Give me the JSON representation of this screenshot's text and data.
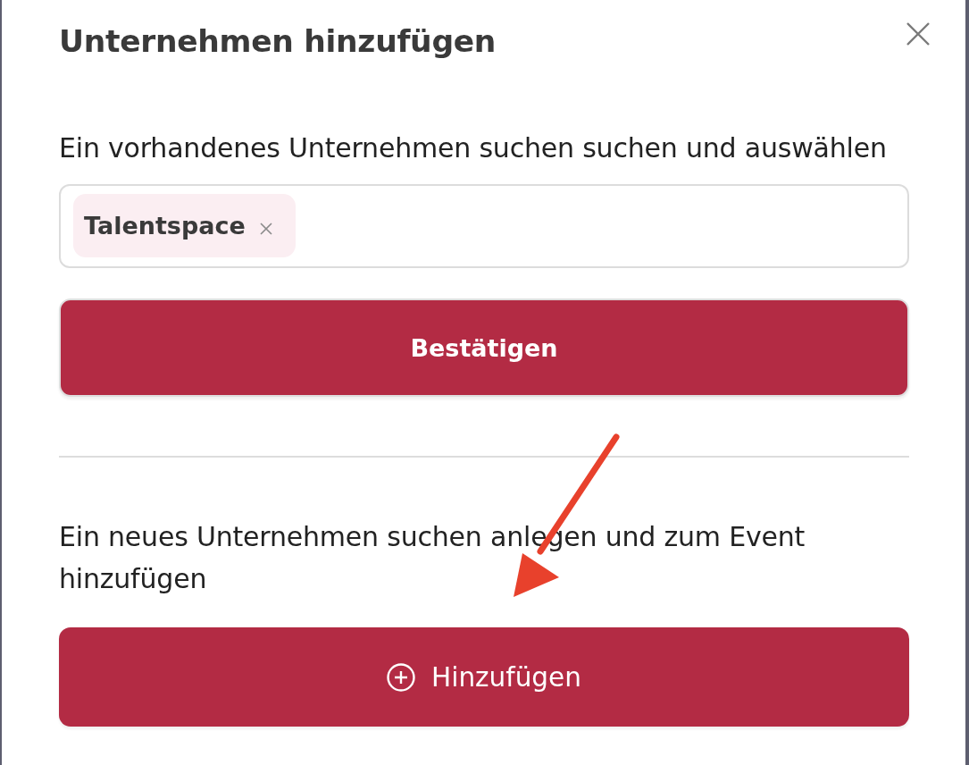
{
  "dialog": {
    "title": "Unternehmen hinzufügen"
  },
  "existing": {
    "label": "Ein vorhandenes Unternehmen suchen suchen und auswählen",
    "tags": [
      {
        "label": "Talentspace"
      }
    ],
    "button": "Bestätigen"
  },
  "create": {
    "label": "Ein neues Unternehmen suchen anlegen und zum Event hinzufügen",
    "button": "Hinzufügen"
  }
}
